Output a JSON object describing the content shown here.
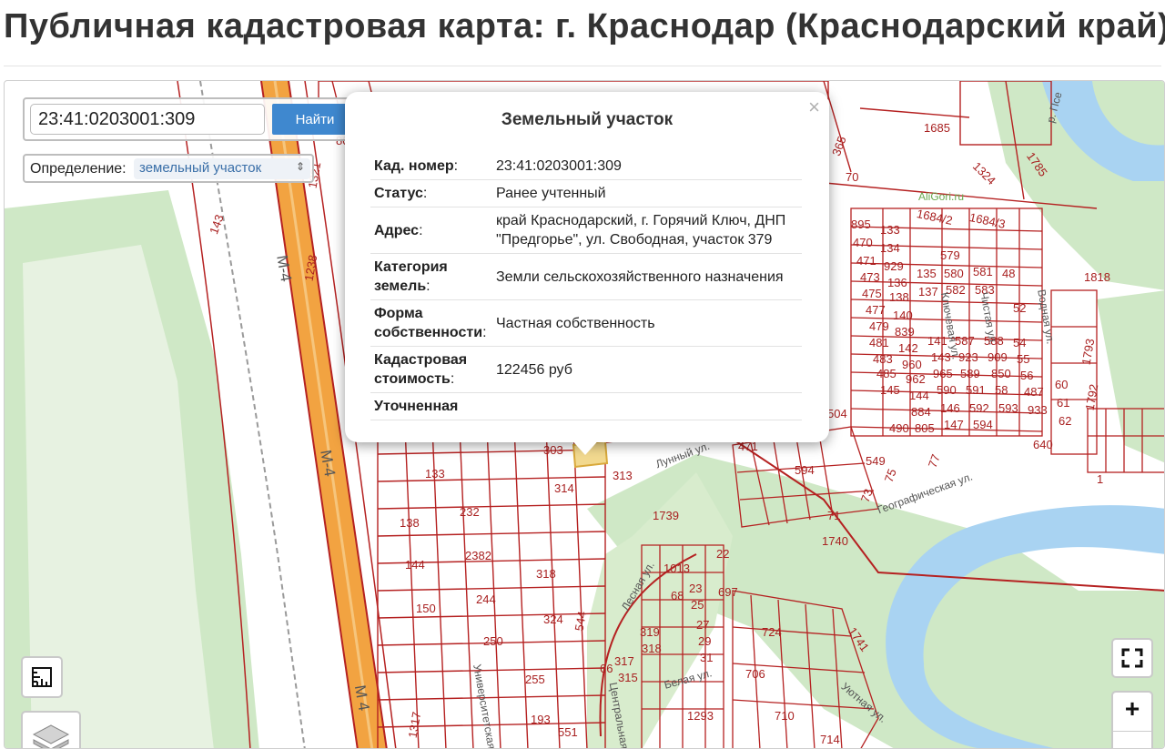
{
  "page": {
    "title": "Публичная кадастровая карта: г. Краснодар (Краснодарский край)"
  },
  "search": {
    "value": "23:41:0203001:309",
    "button_label": "Найти"
  },
  "definition": {
    "label": "Определение:",
    "selected": "земельный участок"
  },
  "popup": {
    "title": "Земельный участок",
    "close_glyph": "×",
    "rows": [
      {
        "key": "Кад. номер",
        "value": "23:41:0203001:309"
      },
      {
        "key": "Статус",
        "value": "Ранее учтенный"
      },
      {
        "key": "Адрес",
        "value": "край Краснодарский, г. Горячий Ключ, ДНП \"Предгорье\", ул. Свободная, участок 379"
      },
      {
        "key": "Категория земель",
        "value": "Земли сельскохозяйственного назначения"
      },
      {
        "key": "Форма собственности",
        "value": "Частная собственность"
      },
      {
        "key": "Кадастровая стоимость",
        "value": "122456 руб"
      },
      {
        "key": "Уточненная",
        "value": ""
      }
    ]
  },
  "map": {
    "colors": {
      "parcel_line": "#b52121",
      "green": "#cfe8c6",
      "river": "#a9d3f2",
      "highway": "#f2a341"
    },
    "parcel_labels": [
      "1685",
      "1324",
      "1785",
      "365",
      "70",
      "1684/2",
      "1684/3",
      "895",
      "133",
      "470",
      "134",
      "471",
      "929",
      "473",
      "136",
      "579",
      "135",
      "580",
      "581",
      "48",
      "1818",
      "475",
      "138",
      "137",
      "582",
      "583",
      "52",
      "477",
      "140",
      "479",
      "839",
      "142",
      "141",
      "587",
      "588",
      "54",
      "481",
      "960",
      "143",
      "923",
      "909",
      "55",
      "483",
      "962",
      "965",
      "589",
      "850",
      "56",
      "485",
      "144",
      "590",
      "591",
      "58",
      "487",
      "145",
      "884",
      "146",
      "592",
      "593",
      "933",
      "60",
      "490",
      "805",
      "147",
      "594",
      "61",
      "62",
      "1793",
      "1792",
      "640",
      "504",
      "549",
      "303",
      "313",
      "1739",
      "1740",
      "1741",
      "1013",
      "22",
      "23",
      "25",
      "697",
      "68",
      "27",
      "29",
      "31",
      "724",
      "319",
      "318",
      "317",
      "315",
      "706",
      "66",
      "1293",
      "193",
      "551",
      "133",
      "232",
      "138",
      "2382",
      "144",
      "318",
      "244",
      "150",
      "324",
      "544",
      "250",
      "255",
      "1317",
      "1321",
      "1238",
      "143",
      "80",
      "71",
      "73",
      "75",
      "77",
      "594",
      "471",
      "314",
      "710",
      "714",
      "1"
    ],
    "street_labels": [
      "М-4",
      "М-4",
      "М 4",
      "Географическая ул.",
      "Лунный ул.",
      "Лесная ул.",
      "Белая ул.",
      "Уютная ул.",
      "Ключевая ул.",
      "Чистая ул.",
      "Водная ул.",
      "р. Псе",
      "AliGori.ru",
      "Университетская ул.",
      "Центральная ул."
    ]
  },
  "controls": {
    "fullscreen_icon": "fullscreen-icon",
    "zoom_in": "+",
    "ruler_icon": "ruler-icon",
    "layers_icon": "layers-icon"
  }
}
